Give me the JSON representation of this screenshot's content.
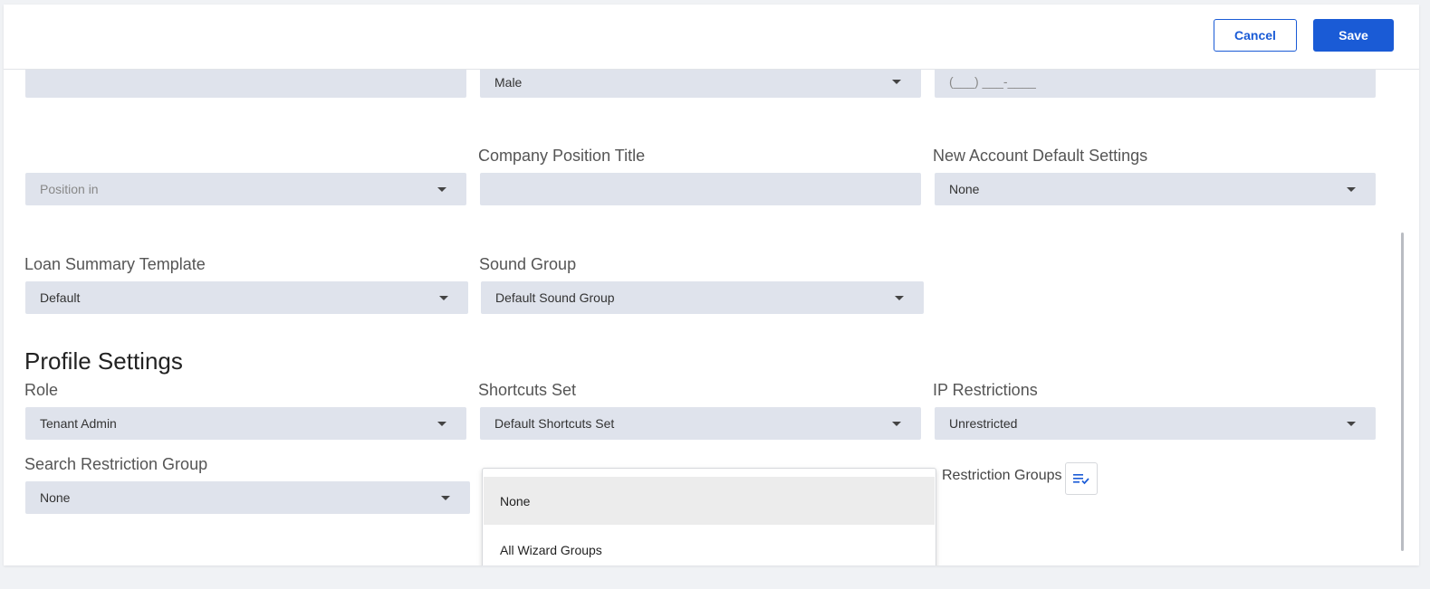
{
  "header": {
    "cancel_label": "Cancel",
    "save_label": "Save"
  },
  "row0": {
    "field1_value": "",
    "gender_value": "Male",
    "phone_value": "(___) ___-____"
  },
  "row1": {
    "position_placeholder": "Position in",
    "company_position_title_label": "Company Position Title",
    "company_position_title_value": "",
    "new_account_default_settings_label": "New Account Default Settings",
    "new_account_default_settings_value": "None"
  },
  "row2": {
    "loan_summary_template_label": "Loan Summary Template",
    "loan_summary_template_value": "Default",
    "sound_group_label": "Sound Group",
    "sound_group_value": "Default Sound Group"
  },
  "profile_settings": {
    "title": "Profile Settings",
    "role_label": "Role",
    "role_value": "Tenant Admin",
    "shortcuts_set_label": "Shortcuts Set",
    "shortcuts_set_value": "Default Shortcuts Set",
    "ip_restrictions_label": "IP Restrictions",
    "ip_restrictions_value": "Unrestricted",
    "search_restriction_group_label": "Search Restriction Group",
    "search_restriction_group_value": "None",
    "restriction_groups_label": "Restriction Groups",
    "restriction_groups_icon": "playlist-check-icon"
  },
  "dropdown": {
    "options": [
      "None",
      "All Wizard Groups"
    ],
    "highlighted": "None"
  },
  "colors": {
    "accent": "#1a5bd6",
    "field_bg": "#dfe3ec"
  }
}
